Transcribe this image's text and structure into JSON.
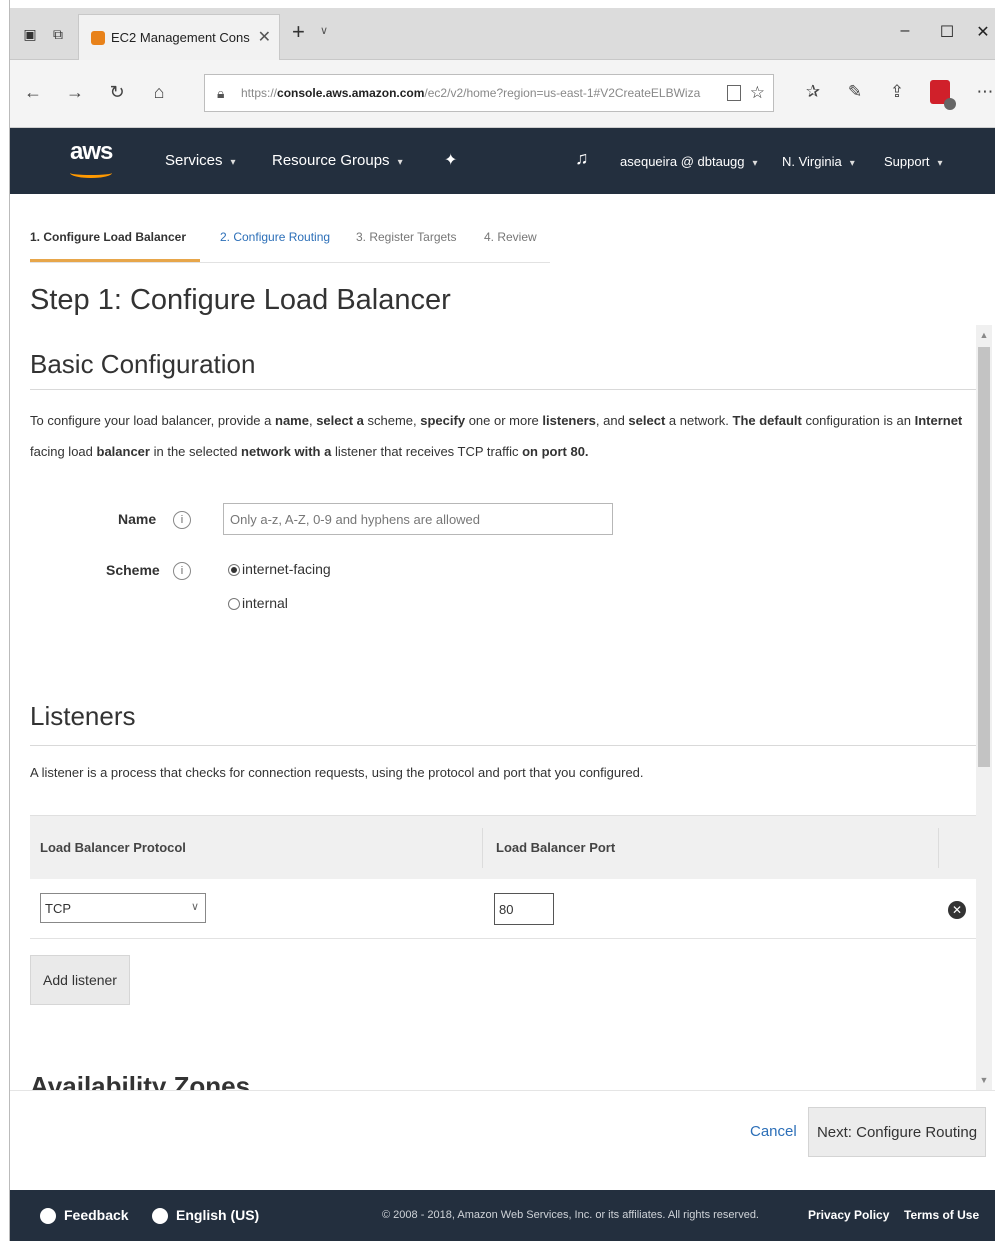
{
  "browser": {
    "tab_title": "EC2 Management Cons",
    "url_prefix": "https://",
    "url_host": "console.aws.amazon.com",
    "url_path": "/ec2/v2/home?region=us-east-1#V2CreateELBWiza"
  },
  "aws_nav": {
    "logo": "aws",
    "services": "Services",
    "resource_groups": "Resource Groups",
    "user": "asequeira @ dbtaugg",
    "region": "N. Virginia",
    "support": "Support"
  },
  "wizard": {
    "steps": [
      {
        "label": "1. Configure Load Balancer"
      },
      {
        "label": "2. Configure Routing"
      },
      {
        "label": "3. Register Targets"
      },
      {
        "label": "4. Review"
      }
    ]
  },
  "page": {
    "title": "Step 1: Configure Load Balancer"
  },
  "basic": {
    "heading": "Basic Configuration",
    "desc_1": "To configure your load balancer, provide a ",
    "desc_name": "name",
    "desc_2": ", ",
    "desc_select": "select a",
    "desc_3": " scheme, ",
    "desc_specify": "specify",
    "desc_4": " one or more ",
    "desc_listeners": "listeners",
    "desc_5": ", and ",
    "desc_select2": "select",
    "desc_6": " a network. ",
    "desc_default": "The default",
    "desc_7": " configuration is an ",
    "desc_internet": "Internet",
    "desc_8": " facing load ",
    "desc_balancer": "balancer",
    "desc_9": " in the selected ",
    "desc_network": "network",
    "desc_with": " with a",
    "desc_10": " listener that receives TCP traffic ",
    "desc_port": "on port 80.",
    "name_label": "Name",
    "name_placeholder": "Only a-z, A-Z, 0-9 and hyphens are allowed",
    "scheme_label": "Scheme",
    "scheme_options": [
      "internet-facing",
      "internal"
    ],
    "scheme_selected": "internet-facing"
  },
  "listeners": {
    "heading": "Listeners",
    "desc": "A listener is a process that checks for connection requests, using the protocol and port that you configured.",
    "col_protocol": "Load Balancer Protocol",
    "col_port": "Load Balancer Port",
    "rows": [
      {
        "protocol": "TCP",
        "port": "80"
      }
    ],
    "add_button": "Add listener"
  },
  "next_section_peek": "Availability Zones",
  "actions": {
    "cancel": "Cancel",
    "next": "Next: Configure Routing"
  },
  "footer": {
    "feedback": "Feedback",
    "language": "English (US)",
    "copyright": "© 2008 - 2018, Amazon Web Services, Inc. or its affiliates. All rights reserved.",
    "privacy": "Privacy Policy",
    "terms": "Terms of Use"
  },
  "colors": {
    "aws_nav_bg": "#232f3e",
    "aws_orange": "#ff9900",
    "link_blue": "#2c6fb8",
    "wizard_active_underline": "#e7a64a"
  }
}
